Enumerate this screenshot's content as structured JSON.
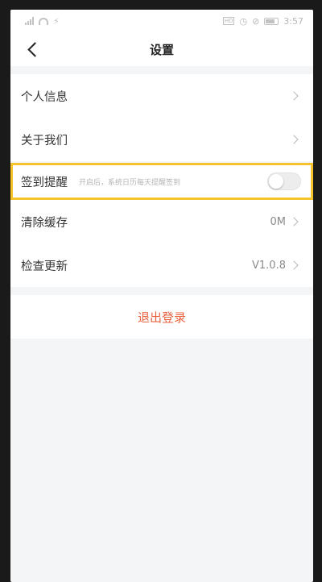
{
  "status_bar": {
    "time": "3:57",
    "hd_label": "HD",
    "icons": [
      "signal-icon",
      "wifi-icon",
      "running-icon",
      "hd-icon",
      "alarm-icon",
      "mute-icon",
      "battery-icon"
    ]
  },
  "header": {
    "title": "设置",
    "back_icon": "chevron-left-icon"
  },
  "settings": {
    "group1": [
      {
        "label": "个人信息",
        "value": ""
      },
      {
        "label": "关于我们",
        "value": ""
      }
    ],
    "remind": {
      "label": "签到提醒",
      "hint": "开启后，系统日历每天提醒签到",
      "enabled": false,
      "highlight_color": "#f5c42c"
    },
    "group2": [
      {
        "label": "清除缓存",
        "value": "0M"
      },
      {
        "label": "检查更新",
        "value": "V1.0.8"
      }
    ]
  },
  "logout": {
    "label": "退出登录",
    "color": "#e8603c"
  }
}
